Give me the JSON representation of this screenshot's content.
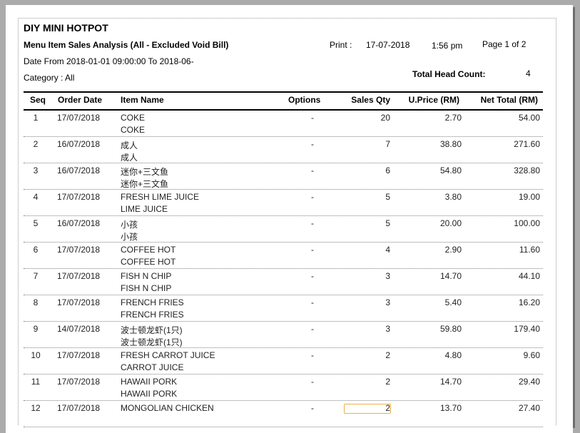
{
  "report": {
    "company": "DIY MINI HOTPOT",
    "title": "Menu Item Sales Analysis (All - Excluded Void Bill)",
    "print_label": "Print :",
    "print_date": "17-07-2018",
    "print_time": "1:56 pm",
    "page_info": "Page 1 of 2",
    "date_range": "Date From 2018-01-01 09:00:00 To 2018-06-",
    "head_count_label": "Total Head Count:",
    "head_count_value": "4",
    "category": "Category : All"
  },
  "columns": [
    "Seq",
    "Order Date",
    "Item Name",
    "Options",
    "Sales Qty",
    "U.Price (RM)",
    "Net Total (RM)"
  ],
  "rows": [
    {
      "seq": "1",
      "date": "17/07/2018",
      "name": "COKE",
      "name2": "COKE",
      "options": "-",
      "qty": "20",
      "price": "2.70",
      "total": "54.00"
    },
    {
      "seq": "2",
      "date": "16/07/2018",
      "name": "成人",
      "name2": "成人",
      "options": "-",
      "qty": "7",
      "price": "38.80",
      "total": "271.60"
    },
    {
      "seq": "3",
      "date": "16/07/2018",
      "name": "迷你+三文鱼",
      "name2": "迷你+三文鱼",
      "options": "-",
      "qty": "6",
      "price": "54.80",
      "total": "328.80"
    },
    {
      "seq": "4",
      "date": "17/07/2018",
      "name": "FRESH LIME JUICE",
      "name2": "LIME JUICE",
      "options": "-",
      "qty": "5",
      "price": "3.80",
      "total": "19.00"
    },
    {
      "seq": "5",
      "date": "16/07/2018",
      "name": "小孩",
      "name2": "小孩",
      "options": "-",
      "qty": "5",
      "price": "20.00",
      "total": "100.00"
    },
    {
      "seq": "6",
      "date": "17/07/2018",
      "name": "COFFEE HOT",
      "name2": "COFFEE HOT",
      "options": "-",
      "qty": "4",
      "price": "2.90",
      "total": "11.60"
    },
    {
      "seq": "7",
      "date": "17/07/2018",
      "name": "FISH N CHIP",
      "name2": "FISH N CHIP",
      "options": "-",
      "qty": "3",
      "price": "14.70",
      "total": "44.10"
    },
    {
      "seq": "8",
      "date": "17/07/2018",
      "name": "FRENCH FRIES",
      "name2": "FRENCH FRIES",
      "options": "-",
      "qty": "3",
      "price": "5.40",
      "total": "16.20"
    },
    {
      "seq": "9",
      "date": "14/07/2018",
      "name": "波士顿龙虾(1只)",
      "name2": "波士顿龙虾(1只)",
      "options": "-",
      "qty": "3",
      "price": "59.80",
      "total": "179.40"
    },
    {
      "seq": "10",
      "date": "17/07/2018",
      "name": "FRESH CARROT JUICE",
      "name2": "CARROT JUICE",
      "options": "-",
      "qty": "2",
      "price": "4.80",
      "total": "9.60"
    },
    {
      "seq": "11",
      "date": "17/07/2018",
      "name": "HAWAII PORK",
      "name2": "HAWAII PORK",
      "options": "-",
      "qty": "2",
      "price": "14.70",
      "total": "29.40"
    },
    {
      "seq": "12",
      "date": "17/07/2018",
      "name": "MONGOLIAN CHICKEN",
      "name2": "",
      "options": "-",
      "qty": "2",
      "price": "13.70",
      "total": "27.40"
    }
  ]
}
